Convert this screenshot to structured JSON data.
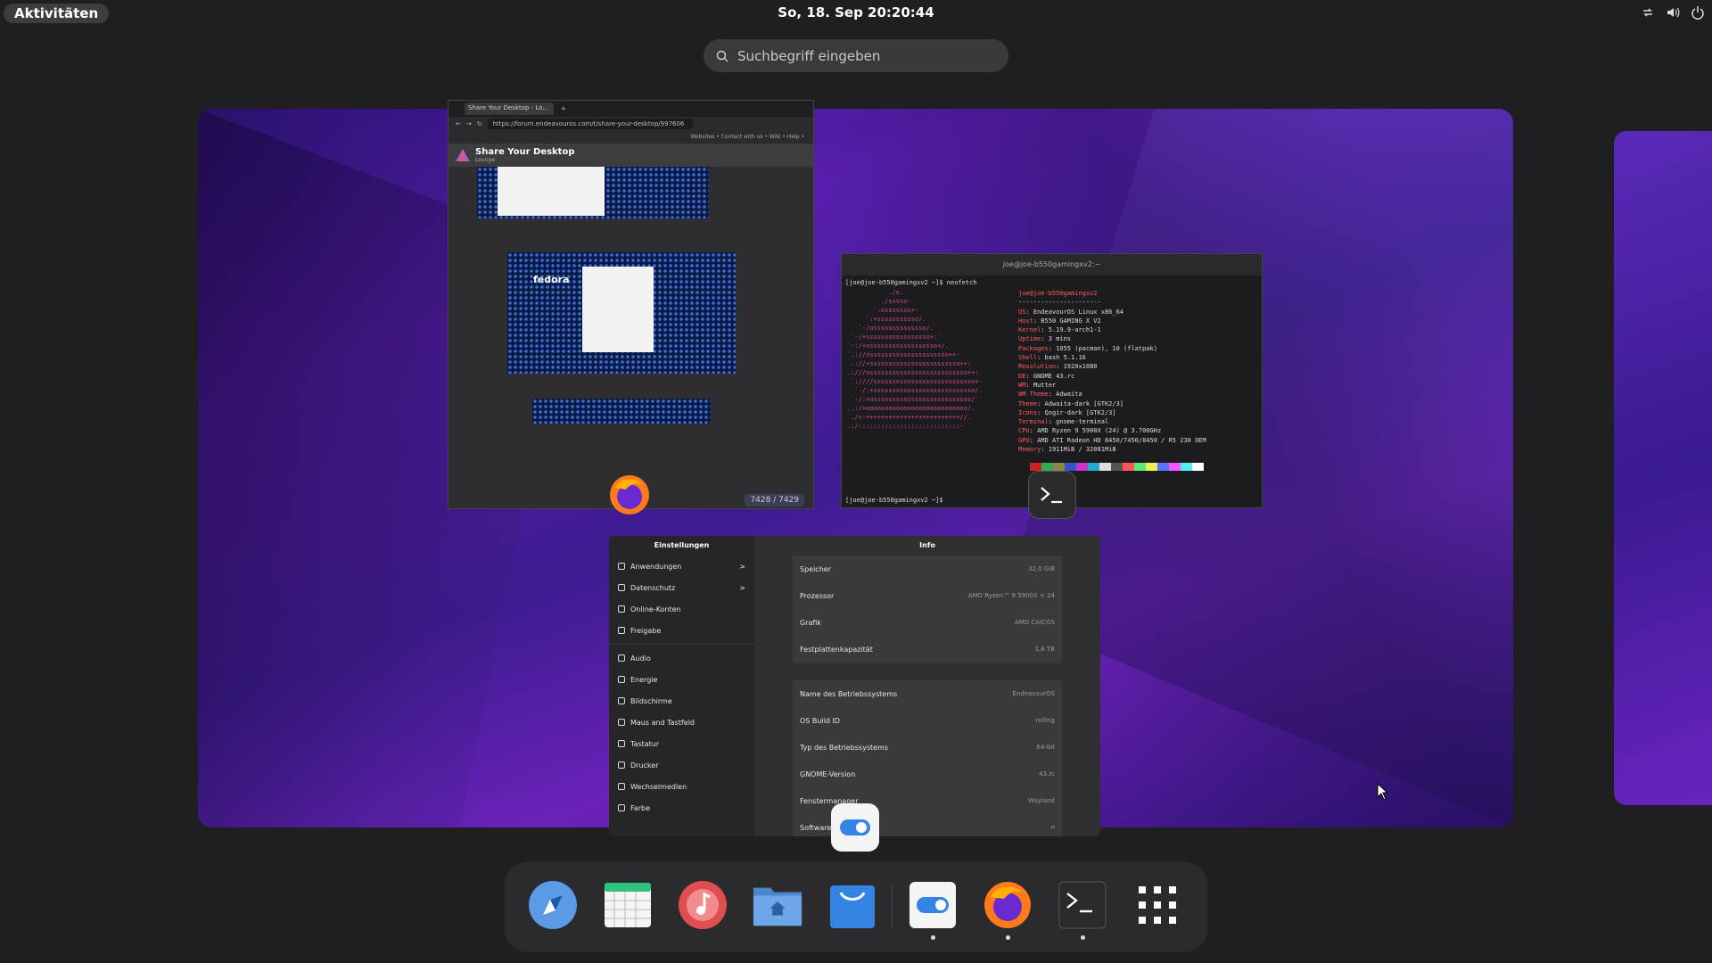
{
  "topbar": {
    "activities": "Aktivitäten",
    "clock": "So, 18. Sep  20:20:44",
    "tray_icons": [
      "network-icon",
      "volume-icon",
      "power-icon"
    ]
  },
  "search": {
    "placeholder": "Suchbegriff eingeben"
  },
  "browser": {
    "tab_title": "Share Your Desktop - Lo...",
    "url": "https://forum.endeavouros.com/t/share-your-desktop/997606",
    "links": "Websites •   Contact with us •   Wiki •   Help •",
    "page_title": "Share Your Desktop",
    "page_sub": "Lounge",
    "embedded_label": "fedora",
    "counter": "7428 / 7429"
  },
  "terminal": {
    "title": "joe@joe-b550gamingxv2:~",
    "command": "[joe@joe-b550gamingxv2 ~]$ neofetch",
    "user_host": "joe@joe-b550gamingxv2",
    "separator": "----------------------",
    "info": [
      {
        "k": "OS",
        "v": "EndeavourOS Linux x86_64"
      },
      {
        "k": "Host",
        "v": "B550 GAMING X V2"
      },
      {
        "k": "Kernel",
        "v": "5.19.9-arch1-1"
      },
      {
        "k": "Uptime",
        "v": "3 mins"
      },
      {
        "k": "Packages",
        "v": "1055 (pacman), 10 (flatpak)"
      },
      {
        "k": "Shell",
        "v": "bash 5.1.16"
      },
      {
        "k": "Resolution",
        "v": "1920x1080"
      },
      {
        "k": "DE",
        "v": "GNOME 43.rc"
      },
      {
        "k": "WM",
        "v": "Mutter"
      },
      {
        "k": "WM Theme",
        "v": "Adwaita"
      },
      {
        "k": "Theme",
        "v": "Adwaita-dark [GTK2/3]"
      },
      {
        "k": "Icons",
        "v": "Qogir-dark [GTK2/3]"
      },
      {
        "k": "Terminal",
        "v": "gnome-terminal"
      },
      {
        "k": "CPU",
        "v": "AMD Ryzen 9 5900X (24) @ 3.700GHz"
      },
      {
        "k": "GPU",
        "v": "AMD ATI Radeon HD 8450/7450/8450 / R5 230 OEM"
      },
      {
        "k": "Memory",
        "v": "1911MiB / 32081MiB"
      }
    ],
    "palette": [
      "#1c1c1e",
      "#cc2222",
      "#33aa55",
      "#888844",
      "#3355cc",
      "#cc33cc",
      "#22aacc",
      "#dddddd",
      "#555555",
      "#ff5555",
      "#55ee77",
      "#eeee55",
      "#5577ff",
      "#ff55ff",
      "#55eeee",
      "#ffffff"
    ],
    "prompt": "[joe@joe-b550gamingxv2 ~]$ "
  },
  "settings": {
    "sidebar_title": "Einstellungen",
    "main_title": "Info",
    "sidebar": [
      {
        "label": "Anwendungen",
        "arrow": ">"
      },
      {
        "label": "Datenschutz",
        "arrow": ">"
      },
      {
        "label": "Online-Konten",
        "arrow": ""
      },
      {
        "label": "Freigabe",
        "arrow": ""
      },
      {
        "label": "Audio",
        "arrow": ""
      },
      {
        "label": "Energie",
        "arrow": ""
      },
      {
        "label": "Bildschirme",
        "arrow": ""
      },
      {
        "label": "Maus and Tastfeld",
        "arrow": ""
      },
      {
        "label": "Tastatur",
        "arrow": ""
      },
      {
        "label": "Drucker",
        "arrow": ""
      },
      {
        "label": "Wechselmedien",
        "arrow": ""
      },
      {
        "label": "Farbe",
        "arrow": ""
      }
    ],
    "hardware": [
      {
        "k": "Speicher",
        "v": "32,0 GiB"
      },
      {
        "k": "Prozessor",
        "v": "AMD Ryzen™ 9 5900X × 24"
      },
      {
        "k": "Grafik",
        "v": "AMD CAICOS"
      },
      {
        "k": "Festplattenkapazität",
        "v": "1,6 TB"
      }
    ],
    "software": [
      {
        "k": "Name des Betriebssystems",
        "v": "EndeavourOS"
      },
      {
        "k": "OS Build ID",
        "v": "rolling"
      },
      {
        "k": "Typ des Betriebssystems",
        "v": "64-bit"
      },
      {
        "k": "GNOME-Version",
        "v": "43.rc"
      },
      {
        "k": "Fenstermanager",
        "v": "Wayland"
      },
      {
        "k": "Software",
        "v": "n"
      }
    ]
  },
  "dock": {
    "items": [
      "web-browser-icon",
      "calendar-icon",
      "music-icon",
      "files-icon",
      "software-icon",
      "settings-icon",
      "firefox-icon",
      "terminal-icon",
      "app-grid-icon"
    ],
    "running": [
      false,
      false,
      false,
      false,
      false,
      true,
      true,
      true,
      false
    ]
  }
}
